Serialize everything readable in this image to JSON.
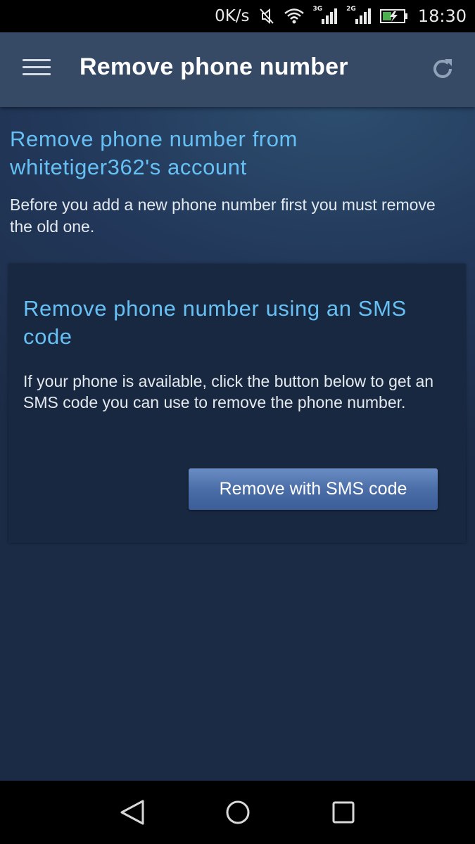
{
  "status_bar": {
    "net_speed": "0K/s",
    "network_1": "3G",
    "network_2": "2G",
    "time": "18:30",
    "icons": [
      "mute-icon",
      "wifi-icon",
      "signal-icon",
      "signal-icon",
      "battery-charging-icon"
    ]
  },
  "app_bar": {
    "title": "Remove phone number",
    "menu_icon": "hamburger-menu-icon",
    "refresh_icon": "refresh-icon"
  },
  "content": {
    "heading": "Remove phone number from whitetiger362's account",
    "intro": "Before you add a new phone number first you must remove the old one.",
    "card": {
      "heading": "Remove phone number using an SMS code",
      "text": "If your phone is available, click the button below to get an SMS code you can use to remove the phone number.",
      "button_label": "Remove with SMS code"
    }
  },
  "nav_bar": {
    "icons": [
      "back-icon",
      "home-icon",
      "recents-icon"
    ]
  },
  "colors": {
    "accent_blue": "#66c0f4",
    "app_bar": "#364a66",
    "card_bg": "#192841",
    "button": "#4b6ea8"
  }
}
